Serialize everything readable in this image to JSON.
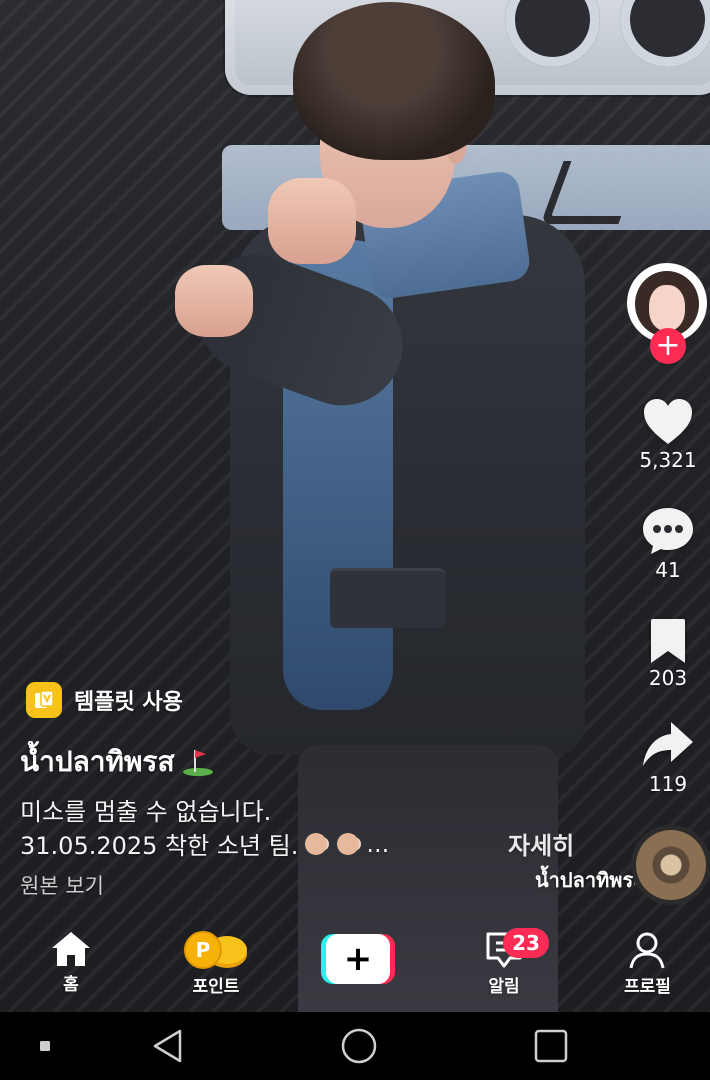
{
  "actions": {
    "likes": "5,321",
    "comments": "41",
    "bookmarks": "203",
    "shares": "119"
  },
  "template": {
    "label": "템플릿 사용"
  },
  "post": {
    "username": "น้ำปลาทิพรส",
    "caption_line1": "미소를 멈출 수 없습니다.",
    "caption_line2": "31.05.2025 착한 소년 팀.",
    "caption_ellipsis": "...",
    "view_original": "원본 보기"
  },
  "sound": {
    "detail_label": "자세히",
    "name": "น้ำปลาทิพรส"
  },
  "nav": {
    "home": "홈",
    "points": "포인트",
    "inbox": "알림",
    "inbox_badge": "23",
    "profile": "프로필"
  },
  "colors": {
    "accent": "#fe2c55",
    "cyan": "#25f4ee",
    "template": "#f7c21a"
  }
}
